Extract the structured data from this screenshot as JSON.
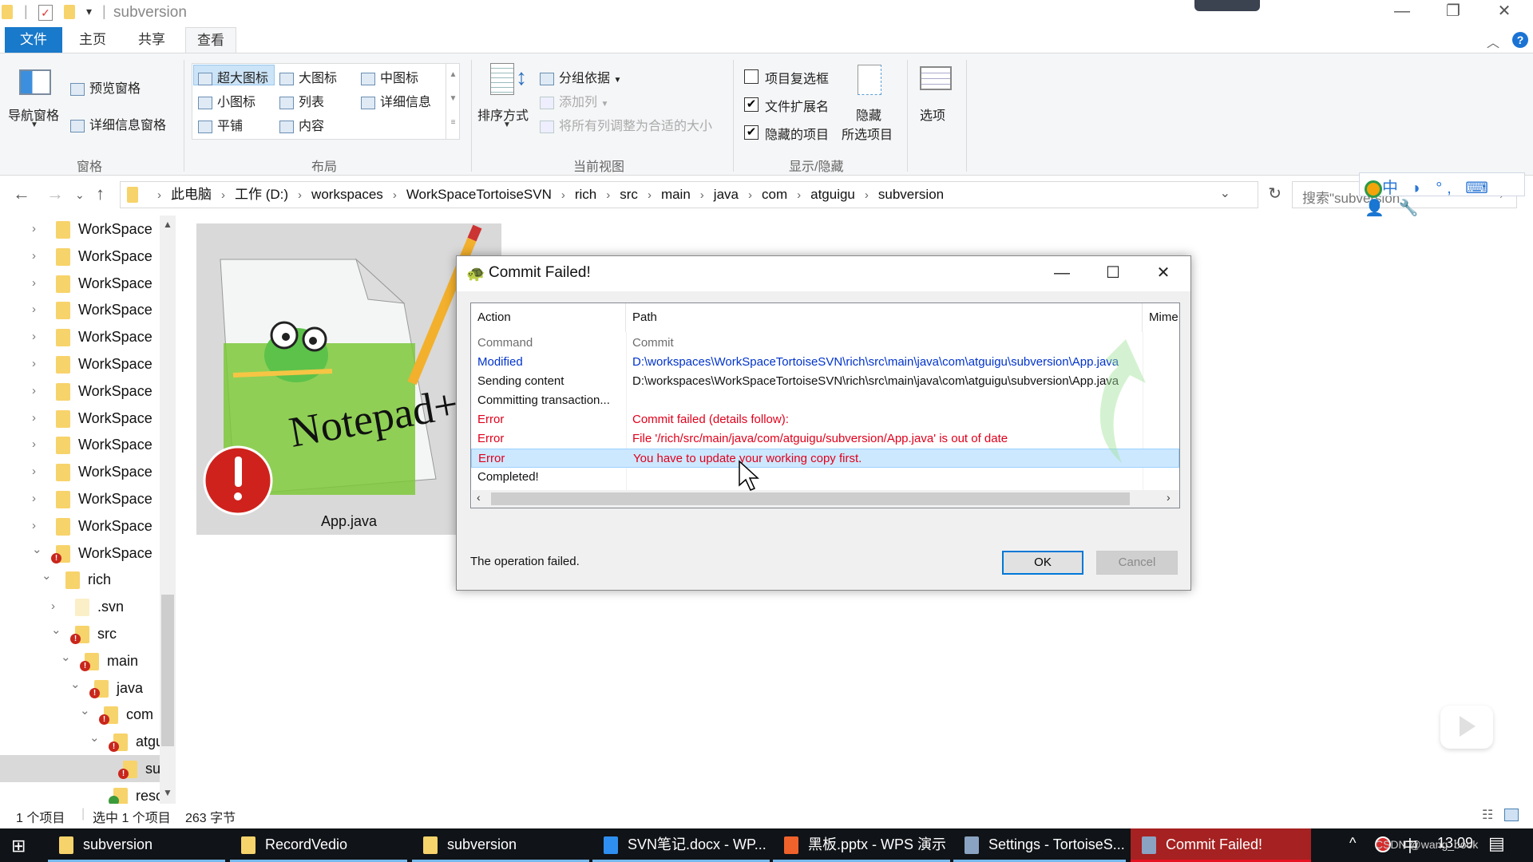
{
  "window": {
    "title": "subversion",
    "controls": {
      "minimize": "—",
      "restore": "❐",
      "close": "✕"
    }
  },
  "ribbon_tabs": [
    {
      "label": "文件"
    },
    {
      "label": "主页"
    },
    {
      "label": "共享"
    },
    {
      "label": "查看",
      "active": true
    }
  ],
  "ribbon": {
    "panes": {
      "nav_pane": "导航窗格",
      "preview_pane": "预览窗格",
      "details_pane": "详细信息窗格",
      "group_title": "窗格"
    },
    "layout": {
      "items": [
        "超大图标",
        "大图标",
        "中图标",
        "小图标",
        "列表",
        "详细信息",
        "平铺",
        "内容"
      ],
      "selected": "超大图标",
      "group_title": "布局"
    },
    "current_view": {
      "sort_by": "排序方式",
      "group_by": "分组依据",
      "add_column": "添加列",
      "size_columns": "将所有列调整为合适的大小",
      "group_title": "当前视图"
    },
    "show_hide": {
      "checkboxes": [
        {
          "label": "项目复选框",
          "checked": false
        },
        {
          "label": "文件扩展名",
          "checked": true
        },
        {
          "label": "隐藏的项目",
          "checked": true
        }
      ],
      "hide_selected_line1": "隐藏",
      "hide_selected_line2": "所选项目",
      "group_title": "显示/隐藏"
    },
    "options": "选项"
  },
  "address": {
    "breadcrumbs": [
      "此电脑",
      "工作 (D:)",
      "workspaces",
      "WorkSpaceTortoiseSVN",
      "rich",
      "src",
      "main",
      "java",
      "com",
      "atguigu",
      "subversion"
    ],
    "search_placeholder": "搜索\"subversion\""
  },
  "ime_toolbar": "中 ◗ °, ⌨ 👤 🔧",
  "nav_tree": [
    {
      "label": "WorkSpace",
      "level": 0,
      "expanded": false,
      "status": "none"
    },
    {
      "label": "WorkSpace",
      "level": 0,
      "expanded": false,
      "status": "none"
    },
    {
      "label": "WorkSpace",
      "level": 0,
      "expanded": false,
      "status": "none"
    },
    {
      "label": "WorkSpace",
      "level": 0,
      "expanded": false,
      "status": "none"
    },
    {
      "label": "WorkSpace",
      "level": 0,
      "expanded": false,
      "status": "none"
    },
    {
      "label": "WorkSpace",
      "level": 0,
      "expanded": false,
      "status": "none"
    },
    {
      "label": "WorkSpace",
      "level": 0,
      "expanded": false,
      "status": "none"
    },
    {
      "label": "WorkSpace",
      "level": 0,
      "expanded": false,
      "status": "none"
    },
    {
      "label": "WorkSpace",
      "level": 0,
      "expanded": false,
      "status": "none"
    },
    {
      "label": "WorkSpace",
      "level": 0,
      "expanded": false,
      "status": "none"
    },
    {
      "label": "WorkSpace",
      "level": 0,
      "expanded": false,
      "status": "none"
    },
    {
      "label": "WorkSpace",
      "level": 0,
      "expanded": false,
      "status": "none"
    },
    {
      "label": "WorkSpace",
      "level": 0,
      "expanded": true,
      "status": "conflict"
    },
    {
      "label": "rich",
      "level": 1,
      "expanded": true,
      "status": "none"
    },
    {
      "label": ".svn",
      "level": 2,
      "expanded": false,
      "status": "none"
    },
    {
      "label": "src",
      "level": 2,
      "expanded": true,
      "status": "conflict"
    },
    {
      "label": "main",
      "level": 3,
      "expanded": true,
      "status": "conflict"
    },
    {
      "label": "java",
      "level": 4,
      "expanded": true,
      "status": "conflict"
    },
    {
      "label": "com",
      "level": 5,
      "expanded": true,
      "status": "conflict"
    },
    {
      "label": "atgu",
      "level": 6,
      "expanded": true,
      "status": "conflict"
    },
    {
      "label": "su",
      "level": 7,
      "expanded": null,
      "status": "conflict",
      "selected": true
    },
    {
      "label": "resour",
      "level": 6,
      "expanded": null,
      "status": "normal"
    }
  ],
  "content": {
    "file_name": "App.java",
    "icon": "notepad-plus-plus-icon",
    "overlay": "conflict-overlay-icon"
  },
  "dialog": {
    "title": "Commit Failed!",
    "columns": [
      "Action",
      "Path",
      "Mime"
    ],
    "rows": [
      {
        "action": "Command",
        "path": "Commit",
        "color": "gray"
      },
      {
        "action": "Modified",
        "path": "D:\\workspaces\\WorkSpaceTortoiseSVN\\rich\\src\\main\\java\\com\\atguigu\\subversion\\App.java",
        "color": "blue"
      },
      {
        "action": "Sending content",
        "path": "D:\\workspaces\\WorkSpaceTortoiseSVN\\rich\\src\\main\\java\\com\\atguigu\\subversion\\App.java",
        "color": "black"
      },
      {
        "action": "Committing transaction...",
        "path": "",
        "color": "black"
      },
      {
        "action": "Error",
        "path": "Commit failed (details follow):",
        "color": "red"
      },
      {
        "action": "Error",
        "path": "File '/rich/src/main/java/com/atguigu/subversion/App.java' is out of date",
        "color": "red"
      },
      {
        "action": "Error",
        "path": "You have to update your working copy first.",
        "color": "red",
        "selected": true
      },
      {
        "action": "Completed!",
        "path": "",
        "color": "black"
      }
    ],
    "status": "The operation failed.",
    "ok_label": "OK",
    "cancel_label": "Cancel"
  },
  "statusbar": {
    "item_count": "1 个项目",
    "selection": "选中 1 个项目",
    "size": "263 字节"
  },
  "taskbar": {
    "items": [
      {
        "label": "subversion",
        "icon": "folder"
      },
      {
        "label": "RecordVedio",
        "icon": "folder"
      },
      {
        "label": "subversion",
        "icon": "folder"
      },
      {
        "label": "SVN笔记.docx - WP...",
        "icon": "wps-writer"
      },
      {
        "label": "黑板.pptx - WPS 演示",
        "icon": "wps-presentation"
      },
      {
        "label": "Settings - TortoiseS...",
        "icon": "tortoisesvn"
      },
      {
        "label": "Commit Failed!",
        "icon": "tortoisesvn",
        "active": true
      }
    ],
    "tray": {
      "ime": "中",
      "clock": "13:09"
    }
  },
  "watermark": "CSDN @wang_book"
}
